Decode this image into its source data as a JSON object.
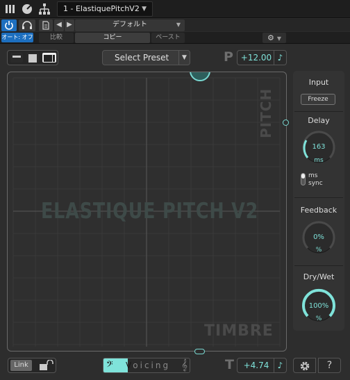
{
  "host": {
    "plugin_title": "1 - ElastiquePitchV2",
    "preset_name": "デフォルト",
    "auto_label": "オート: オフ",
    "compare_label": "比較",
    "copy_label": "コピー",
    "paste_label": "ペースト"
  },
  "plugin": {
    "preset_select": "Select Preset",
    "pitch_letter": "P",
    "pitch_value": "+12.00",
    "pad_watermark": "ELASTIQUE PITCH V2",
    "pad_pitch_label": "PITCH",
    "pad_timbre_label": "TIMBRE",
    "timbre_letter": "T",
    "timbre_value": "+4.74",
    "link_label": "Link",
    "voicing_label": "Voicing",
    "voicing_level": 0.28,
    "accent_color": "#7fe3da",
    "side": {
      "input_label": "Input",
      "freeze_label": "Freeze",
      "delay_label": "Delay",
      "delay_value": "163",
      "delay_unit": "ms",
      "ms_label": "ms",
      "sync_label": "sync",
      "feedback_label": "Feedback",
      "feedback_value": "0%",
      "feedback_unit": "%",
      "drywet_label": "Dry/Wet",
      "drywet_value": "100%",
      "drywet_unit": "%"
    }
  }
}
